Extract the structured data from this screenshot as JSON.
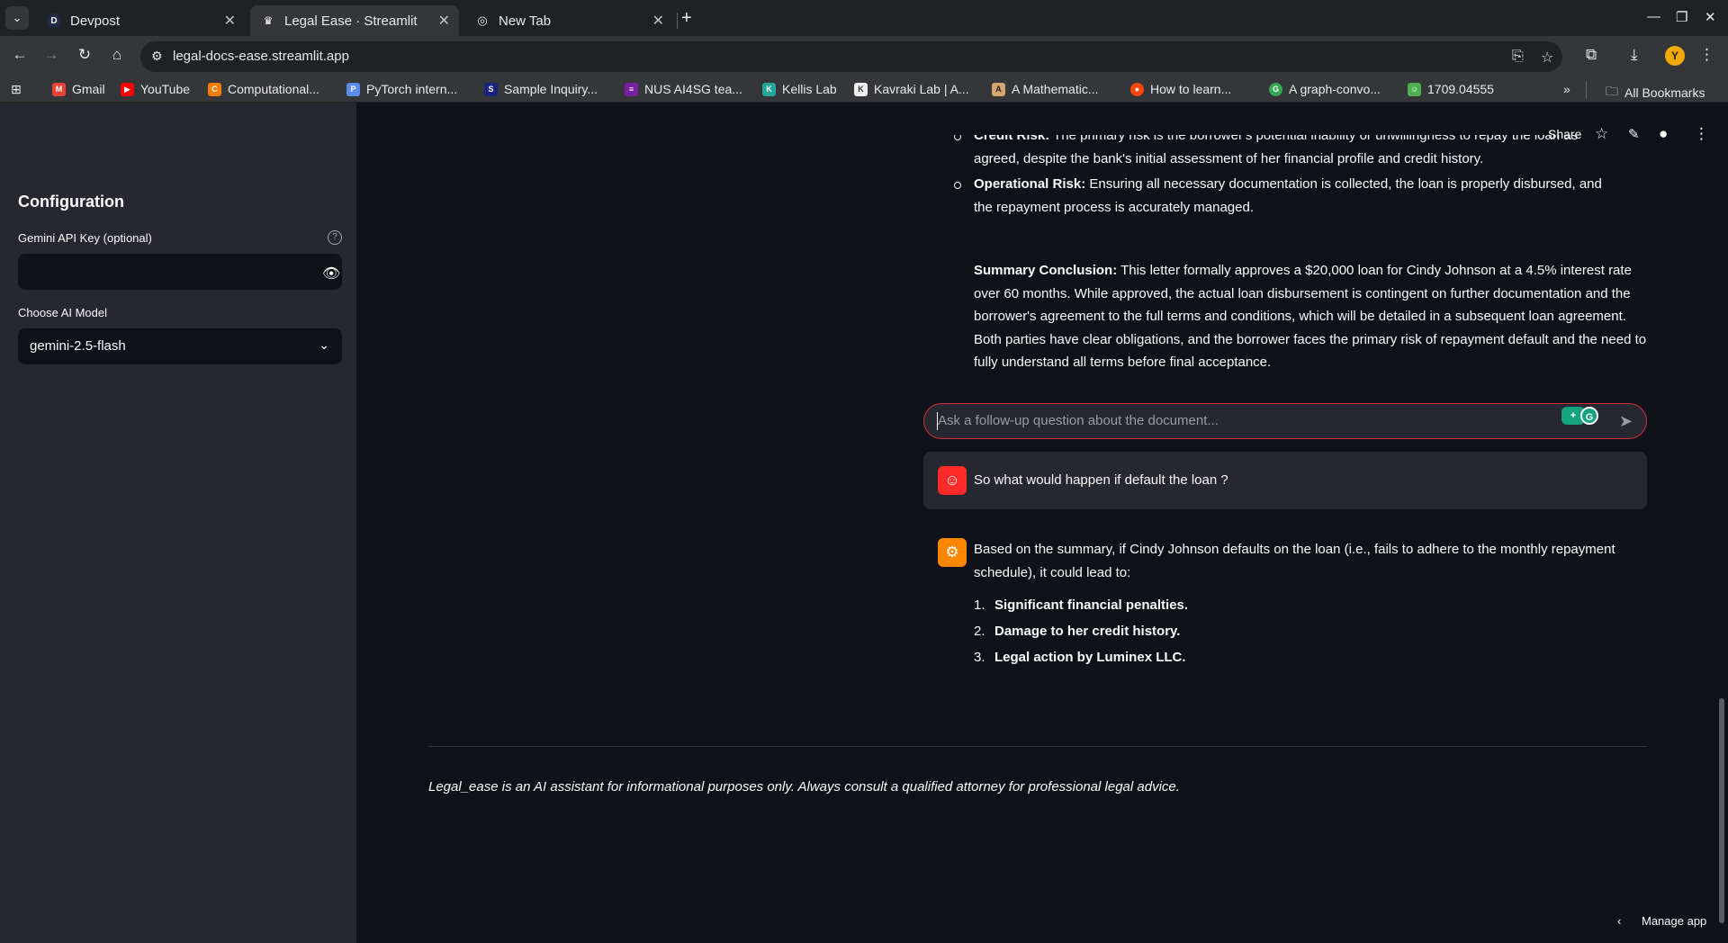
{
  "browser": {
    "tabs": [
      {
        "title": "Devpost",
        "favicon_letter": "D",
        "active": false
      },
      {
        "title": "Legal Ease · Streamlit",
        "favicon_letter": "♛",
        "active": true
      },
      {
        "title": "New Tab",
        "favicon_letter": "◎",
        "active": false
      }
    ],
    "url": "legal-docs-ease.streamlit.app",
    "bookmarks": [
      {
        "label": "Gmail",
        "icon": "gmail-icon",
        "color": "#ea4335",
        "glyph": "M"
      },
      {
        "label": "YouTube",
        "icon": "youtube-icon",
        "color": "#ff0000",
        "glyph": "▶"
      },
      {
        "label": "Computational...",
        "icon": "bookmark-favicon",
        "color": "#f57c00",
        "glyph": "C"
      },
      {
        "label": "PyTorch intern...",
        "icon": "bookmark-favicon",
        "color": "#5b8def",
        "glyph": "P"
      },
      {
        "label": "Sample Inquiry...",
        "icon": "bookmark-favicon",
        "color": "#1a237e",
        "glyph": "S"
      },
      {
        "label": "NUS AI4SG tea...",
        "icon": "bookmark-favicon",
        "color": "#7b1fa2",
        "glyph": "≡"
      },
      {
        "label": "Kellis Lab",
        "icon": "bookmark-favicon",
        "color": "#26a69a",
        "glyph": "K"
      },
      {
        "label": "Kavraki Lab | A...",
        "icon": "bookmark-favicon",
        "color": "#eeeeee",
        "glyph": "K"
      },
      {
        "label": "A Mathematic...",
        "icon": "bookmark-favicon",
        "color": "#d7a46f",
        "glyph": "A"
      },
      {
        "label": "How to learn...",
        "icon": "reddit-icon",
        "color": "#ff4500",
        "glyph": "●"
      },
      {
        "label": "A graph-convo...",
        "icon": "bookmark-favicon",
        "color": "#34a853",
        "glyph": "G"
      },
      {
        "label": "1709.04555",
        "icon": "bookmark-favicon",
        "color": "#4caf50",
        "glyph": "☺"
      }
    ],
    "all_bookmarks_label": "All Bookmarks"
  },
  "sidebar": {
    "title": "Configuration",
    "api_key_label": "Gemini API Key (optional)",
    "api_key_value": "",
    "model_label": "Choose AI Model",
    "model_value": "gemini-2.5-flash"
  },
  "header": {
    "share_label": "Share"
  },
  "main": {
    "partial_bullet": {
      "label": "Credit Risk:",
      "text": " The primary risk is the borrower's potential inability or unwillingness to repay the loan as agreed, despite the bank's initial assessment of her financial profile and credit history."
    },
    "operational_bullet": {
      "label": "Operational Risk:",
      "text": " Ensuring all necessary documentation is collected, the loan is properly disbursed, and the repayment process is accurately managed."
    },
    "summary": {
      "label": "Summary Conclusion:",
      "text": " This letter formally approves a $20,000 loan for Cindy Johnson at a 4.5% interest rate over 60 months. While approved, the actual loan disbursement is contingent on further documentation and the borrower's agreement to the full terms and conditions, which will be detailed in a subsequent loan agreement. Both parties have clear obligations, and the borrower faces the primary risk of repayment default and the need to fully understand all terms before final acceptance."
    },
    "chat_input_placeholder": "Ask a follow-up question about the document...",
    "user_message": "So what would happen if default the loan ?",
    "assistant_intro": "Based on the summary, if Cindy Johnson defaults on the loan (i.e., fails to adhere to the monthly repayment schedule), it could lead to:",
    "assistant_points": [
      {
        "num": "1.",
        "text": "Significant financial penalties."
      },
      {
        "num": "2.",
        "text": "Damage to her credit history."
      },
      {
        "num": "3.",
        "text": "Legal action by Luminex LLC."
      }
    ],
    "disclaimer": "Legal_ease is an AI assistant for informational purposes only. Always consult a qualified attorney for professional legal advice.",
    "manage_app_label": "Manage app"
  }
}
